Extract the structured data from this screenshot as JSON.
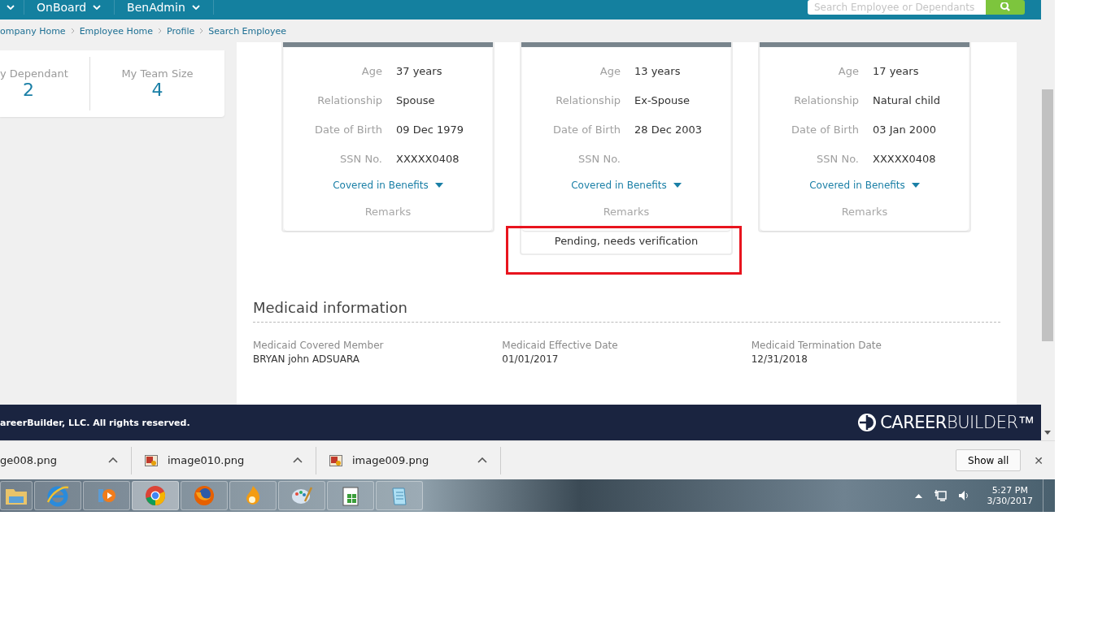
{
  "nav": {
    "items": [
      {
        "label": "OnBoard"
      },
      {
        "label": "BenAdmin"
      }
    ],
    "search": {
      "placeholder": "Search Employee or Dependants"
    }
  },
  "breadcrumbs": [
    "ompany Home",
    "Employee Home",
    "Profile",
    "Search Employee"
  ],
  "stats": [
    {
      "label": "y Dependant",
      "value": "2"
    },
    {
      "label": "My Team Size",
      "value": "4"
    }
  ],
  "dependants": [
    {
      "fields": [
        {
          "label": "Age",
          "value": "37 years"
        },
        {
          "label": "Relationship",
          "value": "Spouse"
        },
        {
          "label": "Date of Birth",
          "value": "09 Dec 1979"
        },
        {
          "label": "SSN No.",
          "value": "XXXXX0408"
        }
      ],
      "benefits_link": "Covered in Benefits",
      "remarks_label": "Remarks"
    },
    {
      "fields": [
        {
          "label": "Age",
          "value": "13 years"
        },
        {
          "label": "Relationship",
          "value": "Ex-Spouse"
        },
        {
          "label": "Date of Birth",
          "value": "28 Dec 2003"
        },
        {
          "label": "SSN No."
        }
      ],
      "benefits_link": "Covered in Benefits",
      "remarks_label": "Remarks",
      "remarks": "Pending, needs verification",
      "highlighted": true
    },
    {
      "fields": [
        {
          "label": "Age",
          "value": "17 years"
        },
        {
          "label": "Relationship",
          "value": "Natural child"
        },
        {
          "label": "Date of Birth",
          "value": "03 Jan 2000"
        },
        {
          "label": "SSN No.",
          "value": "XXXXX0408"
        }
      ],
      "benefits_link": "Covered in Benefits",
      "remarks_label": "Remarks"
    }
  ],
  "medicaid": {
    "title": "Medicaid information",
    "fields": [
      {
        "label": "Medicaid Covered Member",
        "value": "BRYAN john ADSUARA"
      },
      {
        "label": "Medicaid Effective Date",
        "value": "01/01/2017"
      },
      {
        "label": "Medicaid Termination Date",
        "value": "12/31/2018"
      }
    ]
  },
  "footer": {
    "copyright": "areerBuilder, LLC. All rights reserved.",
    "logo": "**CAREER**BUILDER™"
  },
  "downloads": {
    "items": [
      {
        "name": "ge008.png",
        "show_icon": false
      },
      {
        "name": "image010.png",
        "show_icon": true
      },
      {
        "name": "image009.png",
        "show_icon": true
      }
    ],
    "show_all": "Show all",
    "close": "✕"
  },
  "taskbar": {
    "time": "5:27 PM",
    "date": "3/30/2017"
  }
}
